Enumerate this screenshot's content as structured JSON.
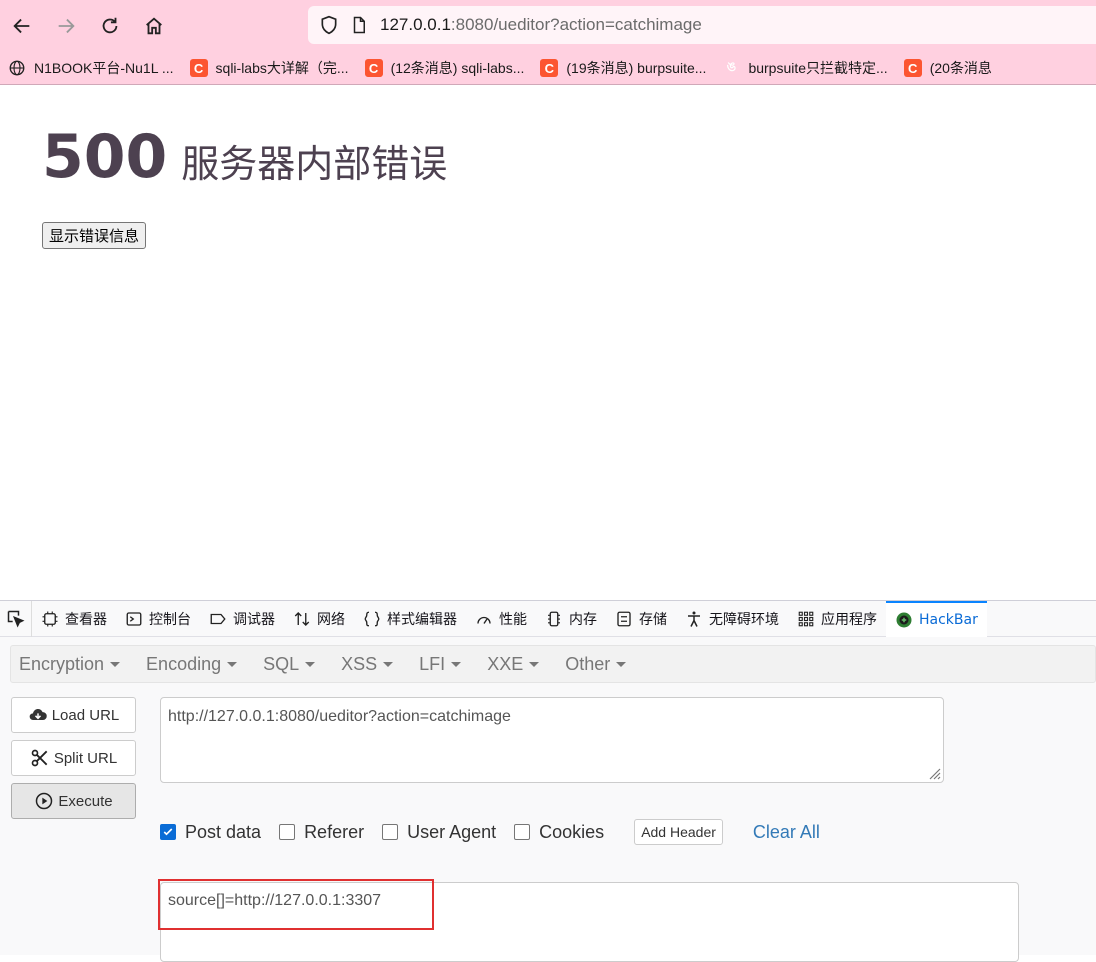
{
  "browser": {
    "url_host": "127.0.0.1",
    "url_rest": ":8080/ueditor?action=catchimage",
    "bookmarks": [
      {
        "label": "N1BOOK平台-Nu1L ...",
        "icon": "globe-icon"
      },
      {
        "label": "sqli-labs大详解（完...",
        "icon": "csdn-icon"
      },
      {
        "label": "(12条消息) sqli-labs...",
        "icon": "csdn-icon"
      },
      {
        "label": "(19条消息) burpsuite...",
        "icon": "csdn-icon"
      },
      {
        "label": "burpsuite只拦截特定...",
        "icon": "site-icon"
      },
      {
        "label": "(20条消息",
        "icon": "csdn-icon"
      }
    ],
    "csdn_glyph": "C",
    "site_glyph": "ঙ"
  },
  "page": {
    "error_code": "500",
    "error_message": "服务器内部错误",
    "show_error_button": "显示错误信息"
  },
  "devtools": {
    "tabs": [
      {
        "label": "查看器",
        "icon": "inspector-icon"
      },
      {
        "label": "控制台",
        "icon": "console-icon"
      },
      {
        "label": "调试器",
        "icon": "debugger-icon"
      },
      {
        "label": "网络",
        "icon": "network-icon"
      },
      {
        "label": "样式编辑器",
        "icon": "style-editor-icon"
      },
      {
        "label": "性能",
        "icon": "performance-icon"
      },
      {
        "label": "内存",
        "icon": "memory-icon"
      },
      {
        "label": "存储",
        "icon": "storage-icon"
      },
      {
        "label": "无障碍环境",
        "icon": "accessibility-icon"
      },
      {
        "label": "应用程序",
        "icon": "application-icon"
      },
      {
        "label": "HackBar",
        "icon": "hackbar-icon"
      }
    ],
    "active_tab": "HackBar"
  },
  "hackbar": {
    "menu": [
      "Encryption",
      "Encoding",
      "SQL",
      "XSS",
      "LFI",
      "XXE",
      "Other"
    ],
    "load_url": "Load URL",
    "split_url": "Split URL",
    "execute": "Execute",
    "url_value": "http://127.0.0.1:8080/ueditor?action=catchimage",
    "options": [
      {
        "label": "Post data",
        "checked": true
      },
      {
        "label": "Referer",
        "checked": false
      },
      {
        "label": "User Agent",
        "checked": false
      },
      {
        "label": "Cookies",
        "checked": false
      }
    ],
    "add_header": "Add Header",
    "clear_all": "Clear All",
    "post_value": "source[]=http://127.0.0.1:3307"
  },
  "colors": {
    "chrome_bg": "#ffd0e0",
    "accent_blue": "#0a6cd6",
    "highlight_red": "#e03030"
  }
}
